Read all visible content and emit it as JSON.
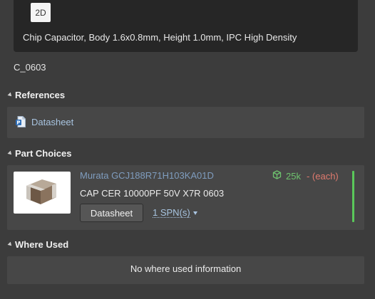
{
  "preview": {
    "view_mode_label": "2D",
    "description": "Chip Capacitor, Body 1.6x0.8mm, Height 1.0mm, IPC High Density"
  },
  "component": {
    "name": "C_0603"
  },
  "references": {
    "title": "References",
    "items": [
      {
        "label": "Datasheet",
        "icon": "datasheet-doc-icon"
      }
    ]
  },
  "part_choices": {
    "title": "Part Choices",
    "items": [
      {
        "title": "Murata GCJ188R71H103KA01D",
        "description": "CAP CER 10000PF 50V X7R 0603",
        "datasheet_button": "Datasheet",
        "spn_label": "1 SPN(s)",
        "stock_count": "25k",
        "stock_price": "- (each)",
        "stock_icon": "cube-icon",
        "status_color": "#5ac85a"
      }
    ]
  },
  "where_used": {
    "title": "Where Used",
    "empty_message": "No where used information"
  },
  "colors": {
    "background": "#3c3c3c",
    "card": "#474747",
    "link": "#a8c4e0",
    "stock_green": "#6ec26e",
    "price_red": "#e07a6e"
  }
}
